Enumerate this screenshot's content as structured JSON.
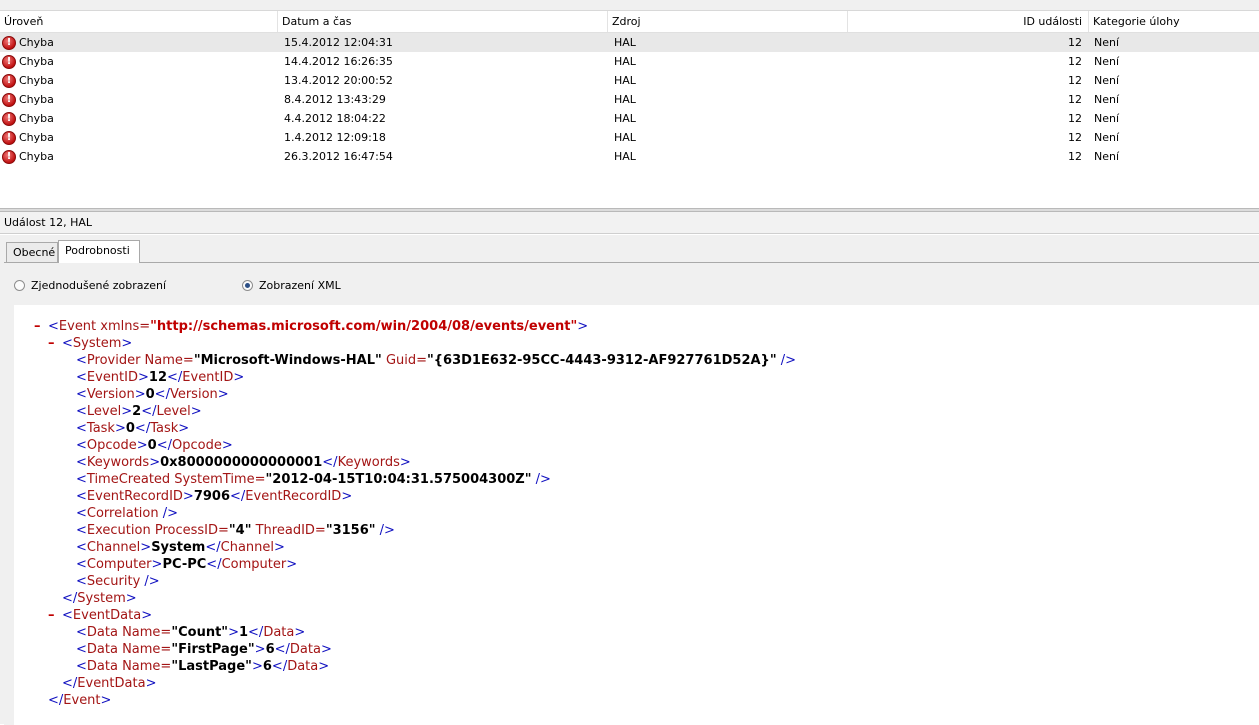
{
  "grid": {
    "columns": [
      "Úroveň",
      "Datum a čas",
      "Zdroj",
      "ID události",
      "Kategorie úlohy"
    ],
    "rows": [
      {
        "level": "Chyba",
        "date": "15.4.2012 12:04:31",
        "source": "HAL",
        "id": "12",
        "category": "Není",
        "icon": "error-icon"
      },
      {
        "level": "Chyba",
        "date": "14.4.2012 16:26:35",
        "source": "HAL",
        "id": "12",
        "category": "Není",
        "icon": "error-icon"
      },
      {
        "level": "Chyba",
        "date": "13.4.2012 20:00:52",
        "source": "HAL",
        "id": "12",
        "category": "Není",
        "icon": "error-icon"
      },
      {
        "level": "Chyba",
        "date": "8.4.2012 13:43:29",
        "source": "HAL",
        "id": "12",
        "category": "Není",
        "icon": "error-icon"
      },
      {
        "level": "Chyba",
        "date": "4.4.2012 18:04:22",
        "source": "HAL",
        "id": "12",
        "category": "Není",
        "icon": "error-icon"
      },
      {
        "level": "Chyba",
        "date": "1.4.2012 12:09:18",
        "source": "HAL",
        "id": "12",
        "category": "Není",
        "icon": "error-icon"
      },
      {
        "level": "Chyba",
        "date": "26.3.2012 16:47:54",
        "source": "HAL",
        "id": "12",
        "category": "Není",
        "icon": "error-icon"
      }
    ]
  },
  "detail": {
    "title": "Událost 12, HAL",
    "tabs": [
      "Obecné",
      "Podrobnosti"
    ],
    "radio_simple": "Zjednodušené zobrazení",
    "radio_xml": "Zobrazení XML"
  },
  "xml": {
    "event_open": "Event xmlns=",
    "event_ns": "\"http://schemas.microsoft.com/win/2004/08/events/event\"",
    "system_open": "System",
    "provider_open": "Provider Name=",
    "provider_name": "\"Microsoft-Windows-HAL\"",
    "provider_guid_attr": " Guid=",
    "provider_guid": "\"{63D1E632-95CC-4443-9312-AF927761D52A}\"",
    "eventid_tag": "EventID",
    "eventid_value": "12",
    "version_tag": "Version",
    "version_value": "0",
    "level_tag": "Level",
    "level_value": "2",
    "task_tag": "Task",
    "task_value": "0",
    "opcode_tag": "Opcode",
    "opcode_value": "0",
    "keywords_tag": "Keywords",
    "keywords_value": "0x8000000000000001",
    "timecreated_tag": "TimeCreated SystemTime=",
    "timecreated_value": "\"2012-04-15T10:04:31.575004300Z\"",
    "recordid_tag": "EventRecordID",
    "recordid_value": "7906",
    "correlation_tag": "Correlation",
    "execution_tag": "Execution ProcessID=",
    "execution_pid": "\"4\"",
    "execution_tid_attr": " ThreadID=",
    "execution_tid": "\"3156\"",
    "channel_tag": "Channel",
    "channel_value": "System",
    "computer_tag": "Computer",
    "computer_value": "PC-PC",
    "security_tag": "Security",
    "system_close": "System",
    "eventdata_open": "EventData",
    "data_tag": "Data Name=",
    "data_close_tag": "Data",
    "data1_name": "\"Count\"",
    "data1_value": "1",
    "data2_name": "\"FirstPage\"",
    "data2_value": "6",
    "data3_name": "\"LastPage\"",
    "data3_value": "6",
    "eventdata_close": "EventData",
    "event_close": "Event"
  }
}
